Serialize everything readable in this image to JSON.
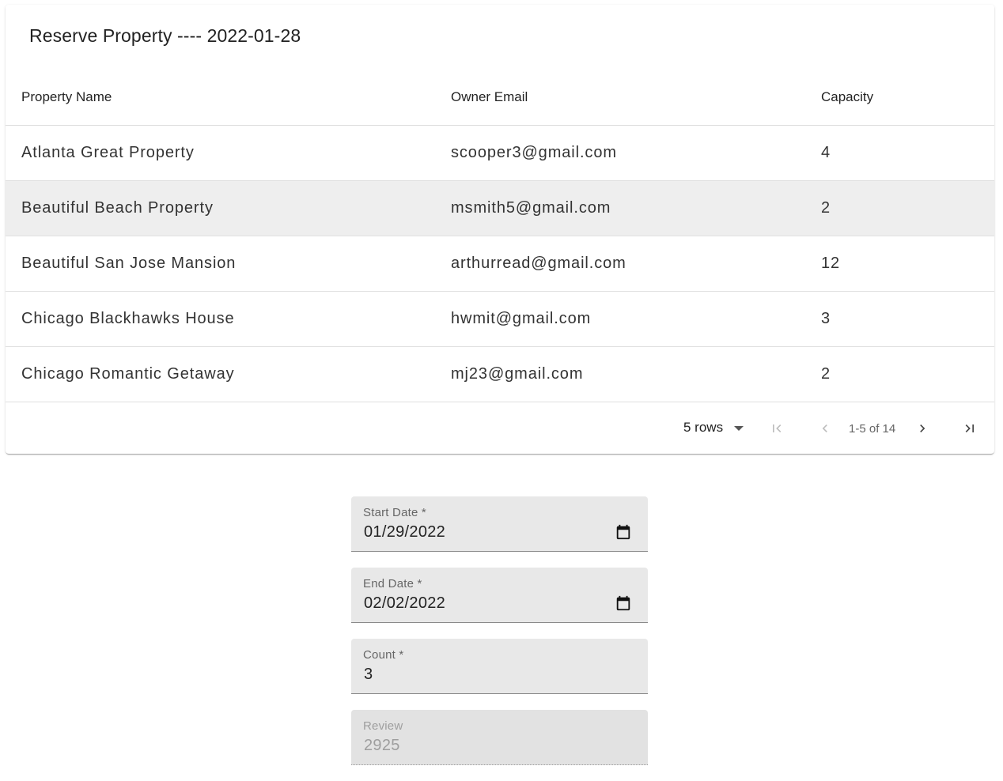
{
  "header": {
    "title": "Reserve Property ---- 2022-01-28"
  },
  "table": {
    "columns": [
      "Property Name",
      "Owner Email",
      "Capacity"
    ],
    "rows": [
      [
        "Atlanta Great Property",
        "scooper3@gmail.com",
        "4"
      ],
      [
        "Beautiful Beach Property",
        "msmith5@gmail.com",
        "2"
      ],
      [
        "Beautiful San Jose Mansion",
        "arthurread@gmail.com",
        "12"
      ],
      [
        "Chicago Blackhawks House",
        "hwmit@gmail.com",
        "3"
      ],
      [
        "Chicago Romantic Getaway",
        "mj23@gmail.com",
        "2"
      ]
    ]
  },
  "pagination": {
    "rows_per_page": "5 rows",
    "range": "1-5 of 14",
    "icons": [
      "first-page-icon",
      "previous-page-icon",
      "next-page-icon",
      "last-page-icon"
    ]
  },
  "form": {
    "start_date": {
      "label": "Start Date *",
      "value": "01/29/2022",
      "icon": "calendar-icon"
    },
    "end_date": {
      "label": "End Date *",
      "value": "02/02/2022",
      "icon": "calendar-icon"
    },
    "count": {
      "label": "Count *",
      "value": "3"
    },
    "review": {
      "label": "Review",
      "value": "2925"
    }
  },
  "colors": {
    "hover_row": "#eeeeee",
    "field_bg": "#e8e8e8",
    "disabled_text": "#9e9e9e"
  }
}
